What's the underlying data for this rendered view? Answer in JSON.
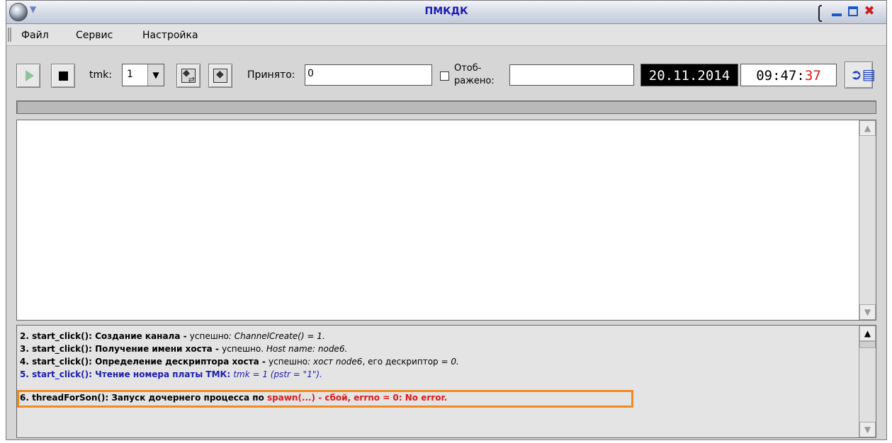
{
  "window": {
    "title": "ПМКДК"
  },
  "menu": {
    "file": "Файл",
    "service": "Сервис",
    "settings": "Настройка"
  },
  "toolbar": {
    "tmk_label": "tmk:",
    "tmk_value": "1",
    "received_label": "Принято:",
    "received_value": "0",
    "displayed_label_1": "Отоб-",
    "displayed_label_2": "ражено:",
    "displayed_value": "",
    "date": "20.11.2014",
    "time_hm": "09:47:",
    "time_sec": "37"
  },
  "icons": {
    "play": "play-icon",
    "stop": "stop-icon",
    "swap": "swap-icon",
    "record": "record-icon",
    "exit": "exit-door-icon",
    "close": "close-icon"
  },
  "colors": {
    "title_text": "#1b1bb5",
    "log_info_blue": "#1c1cb0",
    "log_error_red": "#e01818",
    "highlight_orange": "#f08a22",
    "seconds_red": "#e01818"
  },
  "log": {
    "line2": {
      "bold": "2. start_click(): Создание канала - ",
      "normal": "успешно",
      "italic": ": ChannelCreate() = 1."
    },
    "line3": {
      "bold": "3. start_click(): Получение имени хоста - ",
      "normal": "успешно. ",
      "italic": "Host name: node6."
    },
    "line4": {
      "bold": "4. start_click(): Определение дескриптора хоста - ",
      "normal": "успешно",
      "italic1": ": хост ",
      "italic2": "node6",
      "normal2": ", его дескриптор = ",
      "italic3": "0."
    },
    "line5": {
      "bold": "5. start_click(): Чтение номера платы ТМК: ",
      "italic": "tmk = 1 (pstr = \"1\")."
    },
    "line6": {
      "bold": "6. threadForSon(): Запуск дочернего процесса по ",
      "error": "spawn(...) - сбой, errno = 0: No error."
    }
  }
}
